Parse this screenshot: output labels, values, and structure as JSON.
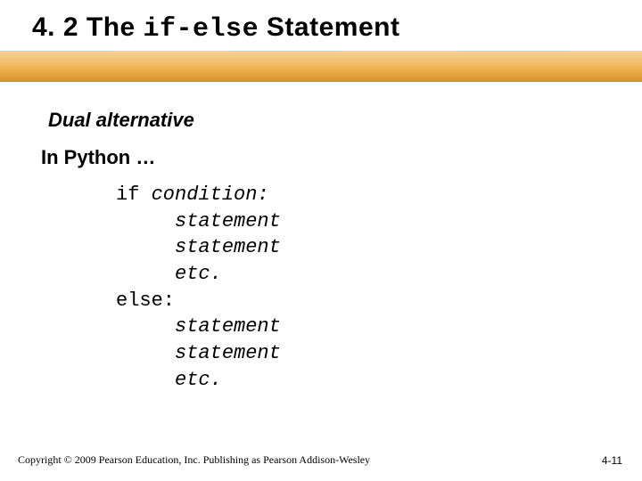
{
  "title": {
    "prefix": "4. 2 The ",
    "code": "if-else",
    "suffix": " Statement"
  },
  "subtitle": "Dual alternative",
  "lead": "In Python …",
  "code": {
    "l1_kw": "if ",
    "l1_em": "condition:",
    "l2": "statement",
    "l3": "statement",
    "l4": "etc.",
    "l5": "else:",
    "l6": "statement",
    "l7": "statement",
    "l8": "etc."
  },
  "footer": {
    "copyright": "Copyright © 2009 Pearson Education, Inc. Publishing as Pearson Addison-Wesley",
    "page": "4-11"
  }
}
